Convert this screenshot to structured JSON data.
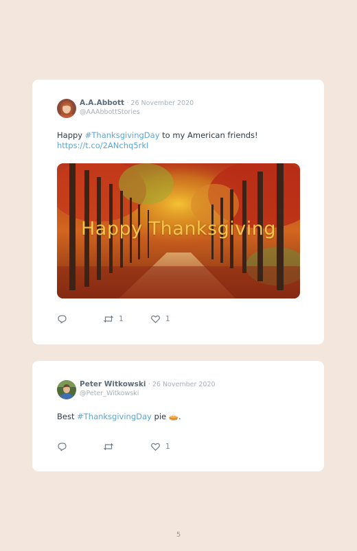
{
  "tweets": [
    {
      "name": "A.A.Abbott",
      "date": "· 26 November 2020",
      "handle": "@AAAbbottStories",
      "text_before": "Happy ",
      "hashtag": "#ThanksgivingDay",
      "text_after": " to my American friends!",
      "link": "https://t.co/2ANchq5rkI",
      "media_caption": "Happy Thanksgiving",
      "retweets": "1",
      "likes": "1"
    },
    {
      "name": "Peter Witkowski",
      "date": "· 26 November 2020",
      "handle": "@Peter_Witkowski",
      "text_before": "Best ",
      "hashtag": "#ThanksgivingDay",
      "text_after": " pie 🥧.",
      "retweets": "",
      "likes": "1"
    }
  ],
  "page_number": "5",
  "colors": {
    "background": "#f2e6dd",
    "card": "#ffffff",
    "accent_link": "#5aa6d6",
    "name": "#5b6b7a",
    "muted": "#a7b0b8",
    "caption": "#f2c64a"
  },
  "icons": [
    "reply-icon",
    "retweet-icon",
    "heart-icon"
  ]
}
